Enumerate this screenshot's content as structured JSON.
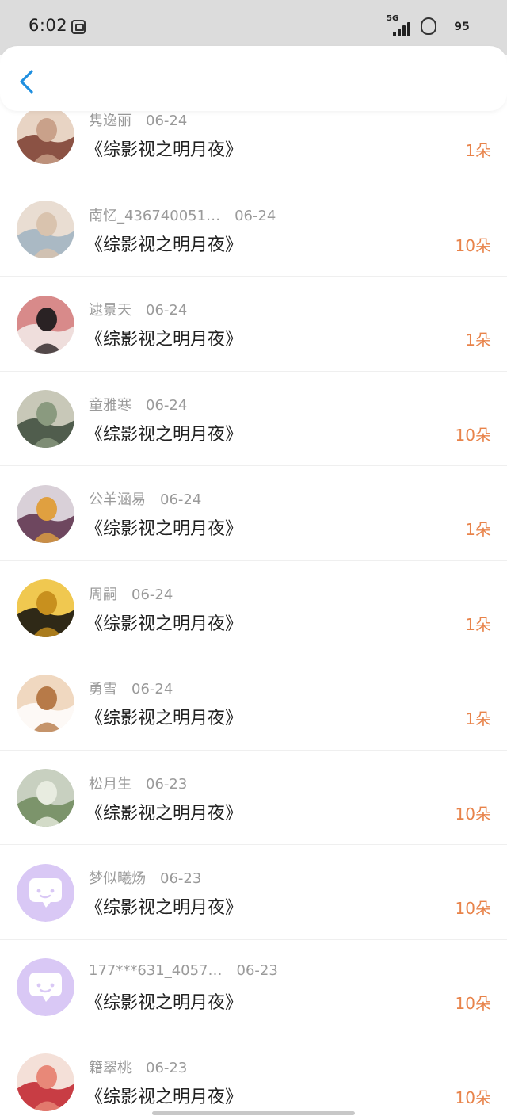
{
  "status_bar": {
    "time": "6:02",
    "network": "5G",
    "battery": "95"
  },
  "rows": [
    {
      "name": "隽逸丽",
      "date": "06-24",
      "title": "《综影视之明月夜》",
      "amount": "1朵",
      "avatar": "avatar-photo"
    },
    {
      "name": "南忆_436740051…",
      "date": "06-24",
      "title": "《综影视之明月夜》",
      "amount": "10朵",
      "avatar": "avatar-photo"
    },
    {
      "name": "逮景天",
      "date": "06-24",
      "title": "《综影视之明月夜》",
      "amount": "1朵",
      "avatar": "avatar-photo"
    },
    {
      "name": "童雅寒",
      "date": "06-24",
      "title": "《综影视之明月夜》",
      "amount": "10朵",
      "avatar": "avatar-photo"
    },
    {
      "name": "公羊涵易",
      "date": "06-24",
      "title": "《综影视之明月夜》",
      "amount": "1朵",
      "avatar": "avatar-photo"
    },
    {
      "name": "周嗣",
      "date": "06-24",
      "title": "《综影视之明月夜》",
      "amount": "1朵",
      "avatar": "avatar-photo"
    },
    {
      "name": "勇雪",
      "date": "06-24",
      "title": "《综影视之明月夜》",
      "amount": "1朵",
      "avatar": "avatar-photo"
    },
    {
      "name": "松月生",
      "date": "06-23",
      "title": "《综影视之明月夜》",
      "amount": "10朵",
      "avatar": "avatar-photo"
    },
    {
      "name": "梦似曦炀",
      "date": "06-23",
      "title": "《综影视之明月夜》",
      "amount": "10朵",
      "avatar": "default-chat-avatar-icon"
    },
    {
      "name": "177***631_4057…",
      "date": "06-23",
      "title": "《综影视之明月夜》",
      "amount": "10朵",
      "avatar": "default-chat-avatar-icon"
    },
    {
      "name": "籍翠桃",
      "date": "06-23",
      "title": "《综影视之明月夜》",
      "amount": "10朵",
      "avatar": "avatar-photo"
    }
  ],
  "colors": {
    "amount": "#e8834a",
    "meta_text": "#9a9a9a",
    "title_text": "#222222",
    "back_icon": "#1f8fe0",
    "default_avatar_bg": "#d9c8f5",
    "status_bar_bg": "#dcdcdc"
  }
}
